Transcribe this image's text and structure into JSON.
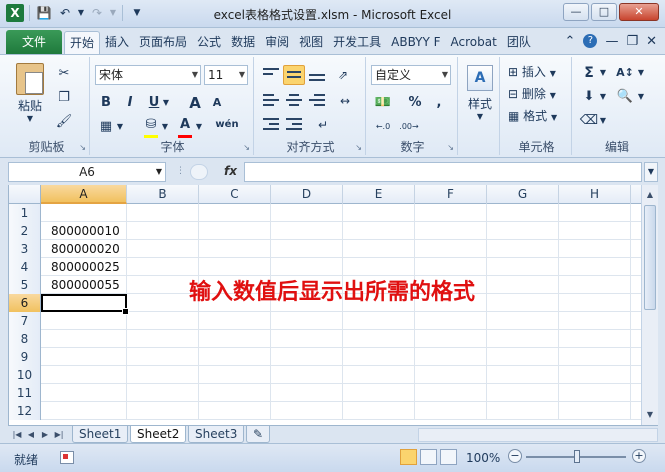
{
  "window": {
    "title": "excel表格格式设置.xlsm - Microsoft Excel",
    "app_logo": "X",
    "minimize": "—",
    "maximize": "□",
    "close": "✕"
  },
  "tabs": {
    "file": "文件",
    "items": [
      "开始",
      "插入",
      "页面布局",
      "公式",
      "数据",
      "审阅",
      "视图",
      "开发工具",
      "ABBYY F",
      "Acrobat",
      "团队"
    ],
    "active": "开始"
  },
  "ribbon": {
    "clipboard": {
      "paste": "粘贴",
      "label": "剪贴板"
    },
    "font": {
      "name": "宋体",
      "size": "11",
      "bold": "B",
      "italic": "I",
      "underline": "U",
      "grow": "A",
      "shrink": "A",
      "wen": "wén",
      "label": "字体"
    },
    "alignment": {
      "label": "对齐方式"
    },
    "number": {
      "format": "自定义",
      "label": "数字",
      "percent": "%",
      "comma": ","
    },
    "styles": {
      "label": "样式"
    },
    "cells": {
      "insert": "插入",
      "delete": "删除",
      "format": "格式",
      "label": "单元格"
    },
    "editing": {
      "label": "编辑",
      "sum": "Σ"
    }
  },
  "formula_bar": {
    "name_box": "A6",
    "fx": "fx",
    "value": ""
  },
  "grid": {
    "columns": [
      "A",
      "B",
      "C",
      "D",
      "E",
      "F",
      "G",
      "H"
    ],
    "selected_column": "A",
    "rows": [
      {
        "n": "1",
        "a": ""
      },
      {
        "n": "2",
        "a": "800000010"
      },
      {
        "n": "3",
        "a": "800000020"
      },
      {
        "n": "4",
        "a": "800000025"
      },
      {
        "n": "5",
        "a": "800000055"
      },
      {
        "n": "6",
        "a": ""
      },
      {
        "n": "7",
        "a": ""
      },
      {
        "n": "8",
        "a": ""
      },
      {
        "n": "9",
        "a": ""
      },
      {
        "n": "10",
        "a": ""
      },
      {
        "n": "11",
        "a": ""
      },
      {
        "n": "12",
        "a": ""
      }
    ],
    "active_row": "6",
    "annotation": "输入数值后显示出所需的格式"
  },
  "sheets": {
    "tabs": [
      "Sheet1",
      "Sheet2",
      "Sheet3"
    ],
    "active": "Sheet2"
  },
  "status": {
    "text": "就绪",
    "zoom": "100%",
    "zoom_minus": "−",
    "zoom_plus": "+"
  },
  "colors": {
    "accent_green": "#1f7a3c",
    "selection_orange": "#f1c15f",
    "annotation_red": "#e01010"
  }
}
